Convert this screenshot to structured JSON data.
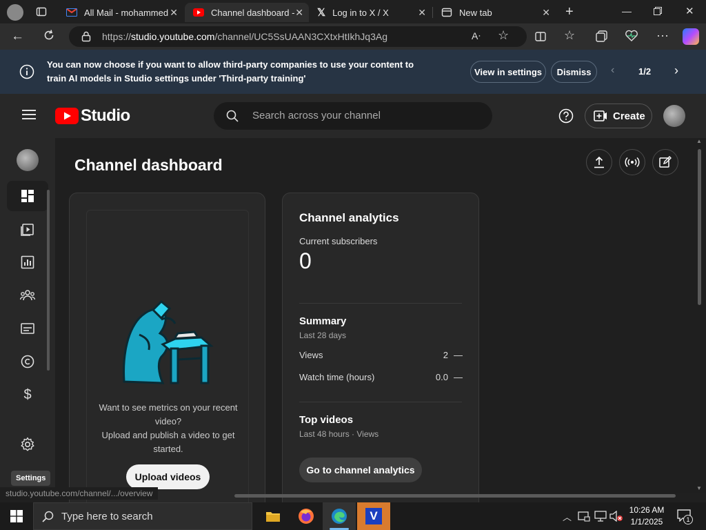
{
  "browser": {
    "tabs": [
      {
        "title": "All Mail - mohammed",
        "icon": "gmail-icon",
        "active": false
      },
      {
        "title": "Channel dashboard - Y",
        "icon": "youtube-icon",
        "active": true
      },
      {
        "title": "Log in to X / X",
        "icon": "x-icon",
        "active": false
      },
      {
        "title": "New tab",
        "icon": "newtab-icon",
        "active": false
      }
    ],
    "url_prefix": "https://",
    "url_host": "studio.youtube.com",
    "url_path": "/channel/UC5SsUAAN3CXtxHtIkhJq3Ag"
  },
  "banner": {
    "text": "You can now choose if you want to allow third-party companies to use your content to train AI models in Studio settings under 'Third-party training'",
    "view_settings": "View in settings",
    "dismiss": "Dismiss",
    "pager": "1/2"
  },
  "header": {
    "logo_text": "Studio",
    "search_placeholder": "Search across your channel",
    "create_label": "Create"
  },
  "page": {
    "title": "Channel dashboard"
  },
  "upload_card": {
    "prompt_line1": "Want to see metrics on your recent",
    "prompt_line2": "video?",
    "prompt_line3": "Upload and publish a video to get",
    "prompt_line4": "started.",
    "upload_button": "Upload videos"
  },
  "analytics": {
    "title": "Channel analytics",
    "subscribers_label": "Current subscribers",
    "subscribers_value": "0",
    "summary_title": "Summary",
    "summary_period": "Last 28 days",
    "rows": [
      {
        "label": "Views",
        "value": "2",
        "trend": "—"
      },
      {
        "label": "Watch time (hours)",
        "value": "0.0",
        "trend": "—"
      }
    ],
    "top_videos_title": "Top videos",
    "top_videos_period": "Last 48 hours · Views",
    "go_button": "Go to channel analytics"
  },
  "tooltip": "Settings",
  "status_url": "studio.youtube.com/channel/.../overview",
  "taskbar": {
    "search_placeholder": "Type here to search",
    "time": "10:26 AM",
    "date": "1/1/2025",
    "notification_count": "1"
  },
  "colors": {
    "youtube_red": "#ff0000",
    "banner_bg": "#273444",
    "studio_bg": "#282828"
  }
}
